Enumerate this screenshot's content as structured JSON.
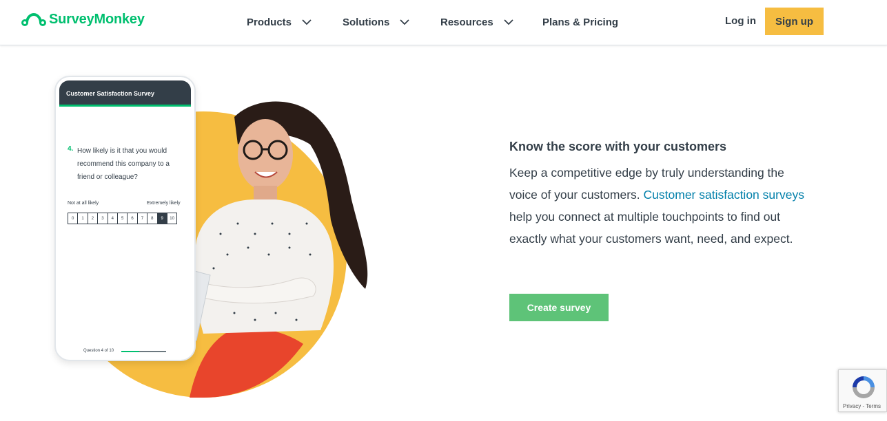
{
  "colors": {
    "brand": "#00bf6f",
    "signup": "#f6bd41",
    "cta": "#5ec378",
    "link": "#007faa",
    "text": "#333e48"
  },
  "header": {
    "logo_text": "SurveyMonkey",
    "nav": [
      {
        "label": "Products",
        "icon": "chevron-down-icon"
      },
      {
        "label": "Solutions",
        "icon": "chevron-down-icon"
      },
      {
        "label": "Resources",
        "icon": "chevron-down-icon"
      },
      {
        "label": "Plans & Pricing"
      }
    ],
    "login": "Log in",
    "signup": "Sign up"
  },
  "phone": {
    "title": "Customer Satisfaction Survey",
    "question_number": "4.",
    "question": "How likely is it that you would recommend this company to a friend or colleague?",
    "scale_low": "Not at all likely",
    "scale_high": "Extremely likely",
    "scale": [
      "0",
      "1",
      "2",
      "3",
      "4",
      "5",
      "6",
      "7",
      "8",
      "9",
      "10"
    ],
    "selected": "9",
    "progress_text": "Question 4 of 10",
    "progress_fraction": 0.4
  },
  "content": {
    "heading": "Know the score with your customers",
    "text_before": "Keep a competitive edge by truly understanding the voice of your customers. ",
    "link": "Customer satisfaction surveys",
    "text_after": " help you connect at multiple touchpoints to find out exactly what your customers want, need, and expect.",
    "cta": "Create survey"
  },
  "recaptcha": {
    "privacy": "Privacy",
    "separator": " - ",
    "terms": "Terms"
  }
}
